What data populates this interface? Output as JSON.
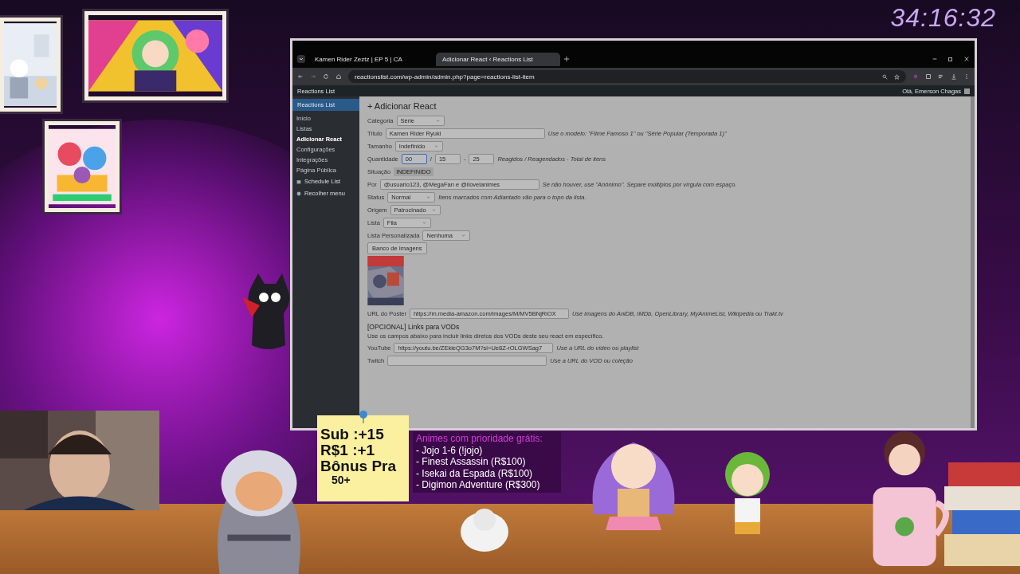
{
  "timer": "34:16:32",
  "browser": {
    "tabs": [
      {
        "label": "Kamen Rider Zeztz | EP 5 | CA",
        "selected": false
      },
      {
        "label": "Adicionar React ‹ Reactions List",
        "selected": true
      }
    ],
    "url": "reactionslist.com/wp-admin/admin.php?page=reactions-list-item",
    "admin_bar": {
      "site": "Reactions List",
      "greeting": "Olá, Emerson Chagas"
    },
    "menu": {
      "header": "Reactions List",
      "items": [
        {
          "label": "Início",
          "selected": false
        },
        {
          "label": "Listas",
          "selected": false
        },
        {
          "label": "Adicionar React",
          "selected": true
        },
        {
          "label": "Configurações",
          "selected": false
        },
        {
          "label": "Integrações",
          "selected": false
        },
        {
          "label": "Página Pública",
          "selected": false
        }
      ],
      "extra": [
        "Schedule List",
        "Recolher menu"
      ]
    },
    "page": {
      "title": "+ Adicionar React",
      "rows": [
        {
          "kind": "select",
          "label": "Categoria",
          "value": "Série"
        },
        {
          "kind": "input",
          "label": "Título",
          "value": "Kamen Rider Ryuki",
          "hint": "Use o modelo: \"Filme Famoso 1\" ou \"Série Popular (Temporada 1)\""
        },
        {
          "kind": "select",
          "label": "Tamanho",
          "value": "Indefinido"
        },
        {
          "kind": "quantity",
          "label": "Quantidade",
          "values": [
            "00",
            "15",
            "25"
          ],
          "separators": [
            "/",
            "-"
          ],
          "hint": "Reagidos / Reagendados - Total de itens"
        },
        {
          "kind": "status",
          "label": "Situação",
          "value": "INDEFINIDO"
        },
        {
          "kind": "input",
          "label": "Por",
          "value": "@usuario123, @MegaFan e @ilovelanimes",
          "hint": "Se não houver, use \"Anônimo\". Separe múltiplos por vírgula com espaço."
        },
        {
          "kind": "select",
          "label": "Status",
          "value": "Normal",
          "hint": "Itens marcados com Adiantado vão para o topo da lista."
        },
        {
          "kind": "select",
          "label": "Origem",
          "value": "Patrocinado"
        },
        {
          "kind": "select",
          "label": "Lista",
          "value": "Fila"
        },
        {
          "kind": "select",
          "label": "Lista Personalizada",
          "value": "Nenhuma"
        },
        {
          "kind": "button",
          "label": "Banco de Imagens"
        },
        {
          "kind": "poster"
        },
        {
          "kind": "input",
          "label": "URL do Poster",
          "value": "https://m.media-amazon.com/images/M/MV5BNjRiOX",
          "hint": "Use imagens do AniDB, IMDb, OpenLibrary, MyAnimeList, Wikipedia ou Trakt.tv"
        },
        {
          "kind": "heading",
          "label": "[OPCIONAL] Links para VODs"
        },
        {
          "kind": "text",
          "label": "Use os campos abaixo para incluir links diretos dos VODs deste seu react em específico."
        },
        {
          "kind": "input",
          "label": "YouTube",
          "value": "https://youtu.be/ZEkieQG3o7M?si=Ue8Z-rOLGWSag7",
          "hint": "Use a URL do vídeo ou playlist"
        },
        {
          "kind": "input",
          "label": "Twitch",
          "hint": "Use a URL do VOD ou coleção"
        }
      ]
    }
  },
  "note": {
    "lines": [
      "Sub :+15",
      "R$1 :+1",
      "Bônus Pra",
      "50+"
    ]
  },
  "priority": {
    "title": "Animes com prioridade grátis:",
    "items": [
      "- Jojo 1-6 (!jojo)",
      "- Finest Assassin (R$100)",
      "- Isekai da Espada (R$100)",
      "- Digimon Adventure (R$300)"
    ]
  }
}
